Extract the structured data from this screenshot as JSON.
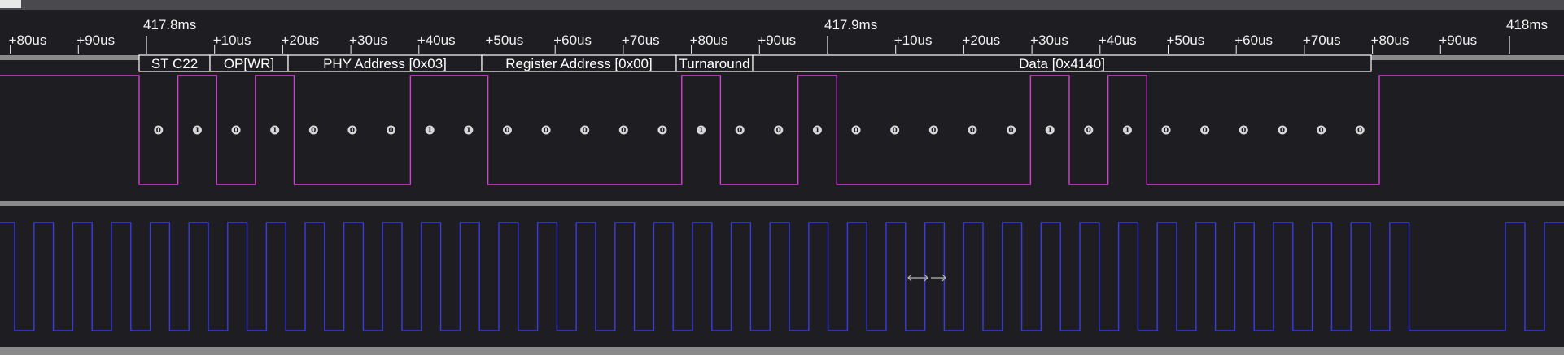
{
  "timeline": {
    "anchors": [
      "417.8ms",
      "417.9ms",
      "418ms"
    ],
    "ticks_left": [
      "+80us",
      "+90us"
    ],
    "ticks_a": [
      "+10us",
      "+20us",
      "+30us",
      "+40us",
      "+50us",
      "+60us",
      "+70us",
      "+80us",
      "+90us"
    ],
    "ticks_b": [
      "+10us",
      "+20us",
      "+30us",
      "+40us",
      "+50us",
      "+60us",
      "+70us",
      "+80us",
      "+90us"
    ]
  },
  "decoder": {
    "segments": [
      {
        "label": "ST C22"
      },
      {
        "label": "OP[WR]"
      },
      {
        "label": "PHY Address [0x03]"
      },
      {
        "label": "Register Address [0x00]"
      },
      {
        "label": "Turnaround"
      },
      {
        "label": "Data [0x4140]"
      }
    ]
  },
  "mdio": {
    "color": "#d63fd6",
    "bits": [
      "0",
      "1",
      "0",
      "1",
      "0",
      "0",
      "0",
      "1",
      "1",
      "0",
      "0",
      "0",
      "0",
      "0",
      "1",
      "0",
      "0",
      "1",
      "0",
      "0",
      "0",
      "0",
      "0",
      "1",
      "0",
      "1",
      "0",
      "0",
      "0",
      "0",
      "0",
      "0"
    ]
  },
  "mdc": {
    "color": "#3a3ae6"
  },
  "colors": {
    "background": "#1e1e22",
    "separator": "#8a8a8a",
    "decoder_bar": "#ffffff",
    "tick_text": "#f0f0f0"
  },
  "cursor_icon": "horizontal-resize-icon"
}
